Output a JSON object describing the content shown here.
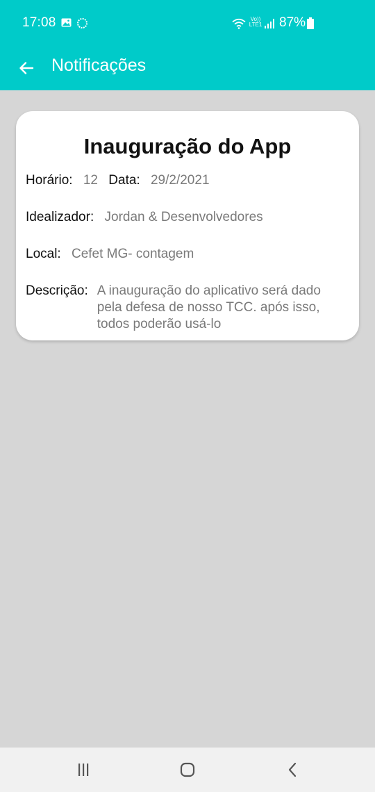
{
  "status_bar": {
    "time": "17:08",
    "volte_line1": "Vo))",
    "volte_line2": "LTE1",
    "battery_pct": "87%",
    "icons": [
      "gallery-icon",
      "sync-icon",
      "wifi-icon",
      "signal-icon",
      "battery-icon"
    ]
  },
  "app_bar": {
    "title": "Notificações",
    "background": "#00cbc9"
  },
  "notification": {
    "title": "Inauguração do App",
    "horario_label": "Horário:",
    "horario_value": "12",
    "data_label": "Data:",
    "data_value": "29/2/2021",
    "idealizador_label": "Idealizador:",
    "idealizador_value": "Jordan & Desenvolvedores",
    "local_label": "Local:",
    "local_value": "Cefet MG- contagem",
    "descricao_label": "Descrição:",
    "descricao_value": "A inauguração do aplicativo será dado\npela defesa de nosso TCC. após isso,\ntodos poderão  usá-lo"
  },
  "nav_bar": {
    "buttons": [
      "recents-icon",
      "home-icon",
      "back-icon"
    ]
  }
}
